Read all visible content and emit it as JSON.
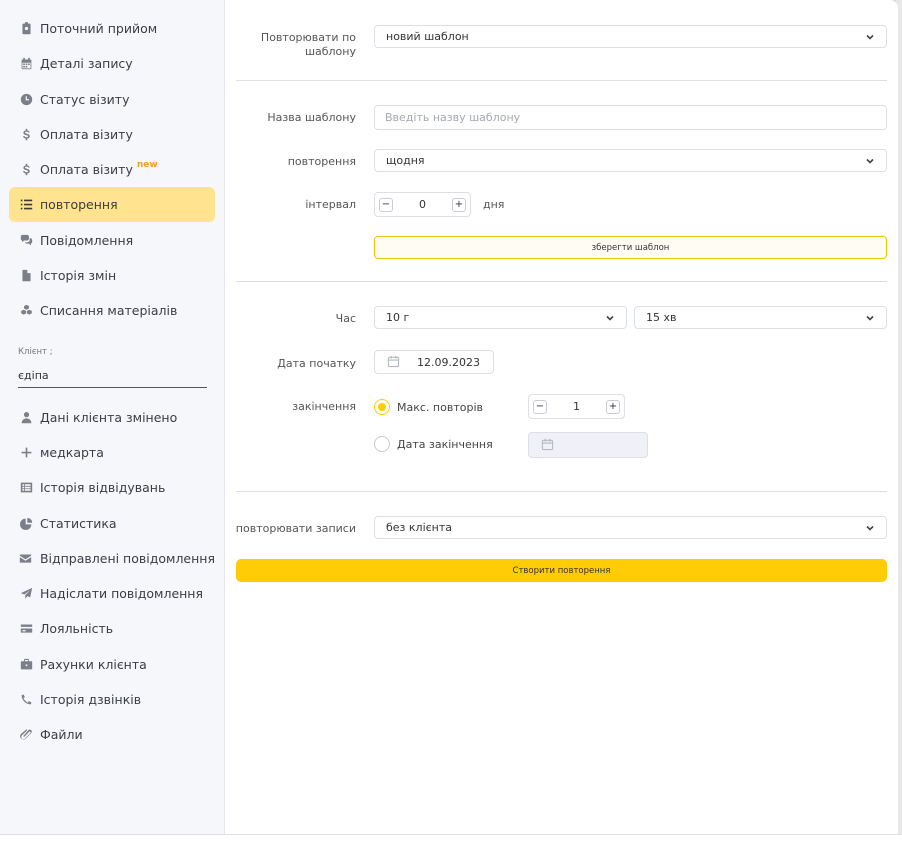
{
  "sidebar": {
    "items": [
      {
        "label": "Поточний прийом",
        "icon": "clipboard-icon"
      },
      {
        "label": "Деталі запису",
        "icon": "calendar-icon"
      },
      {
        "label": "Статус візиту",
        "icon": "clock-icon"
      },
      {
        "label": "Оплата візиту",
        "icon": "dollar-icon"
      },
      {
        "label": "Оплата візиту",
        "icon": "dollar-icon",
        "badge": "new"
      },
      {
        "label": "повторення",
        "icon": "list-icon",
        "active": true
      },
      {
        "label": "Повідомлення",
        "icon": "chat-icon"
      },
      {
        "label": "Історія змін",
        "icon": "document-icon"
      },
      {
        "label": "Списання матеріалів",
        "icon": "cubes-icon"
      }
    ],
    "client": {
      "label": "Клієнт ;",
      "value": "єдіпа"
    },
    "client_items": [
      {
        "label": "Дані клієнта змінено",
        "icon": "user-icon"
      },
      {
        "label": "медкарта",
        "icon": "plus-icon"
      },
      {
        "label": "Історія відвідувань",
        "icon": "list-alt-icon"
      },
      {
        "label": "Статистика",
        "icon": "pie-chart-icon"
      },
      {
        "label": "Відправлені повідомлення",
        "icon": "envelope-icon"
      },
      {
        "label": "Надіслати повідомлення",
        "icon": "paper-plane-icon"
      },
      {
        "label": "Лояльність",
        "icon": "credit-card-icon"
      },
      {
        "label": "Рахунки клієнта",
        "icon": "briefcase-icon"
      },
      {
        "label": "Історія дзвінків",
        "icon": "phone-icon"
      },
      {
        "label": "Файли",
        "icon": "paperclip-icon"
      }
    ]
  },
  "form": {
    "template": {
      "label": "Повторювати по шаблону",
      "value": "новий шаблон"
    },
    "template_name": {
      "label": "Назва шаблону",
      "placeholder": "Введіть назву шаблону"
    },
    "repeat": {
      "label": "повторення",
      "value": "щодня"
    },
    "interval": {
      "label": "інтервал",
      "value": "0",
      "unit": "дня"
    },
    "save_template_label": "зберегти шаблон",
    "time": {
      "label": "Час",
      "hours": "10 г",
      "minutes": "15 хв"
    },
    "start_date": {
      "label": "Дата початку",
      "value": "12.09.2023"
    },
    "end": {
      "label": "закінчення",
      "max_repeats_label": "Макс. повторів",
      "max_repeats_value": "1",
      "end_date_label": "Дата закінчення",
      "selected": "max_repeats"
    },
    "repeat_records": {
      "label": "повторювати записи",
      "value": "без клієнта"
    },
    "create_label": "Створити повторення"
  },
  "colors": {
    "accent": "#ffcc05",
    "active_nav": "#ffe38f"
  }
}
